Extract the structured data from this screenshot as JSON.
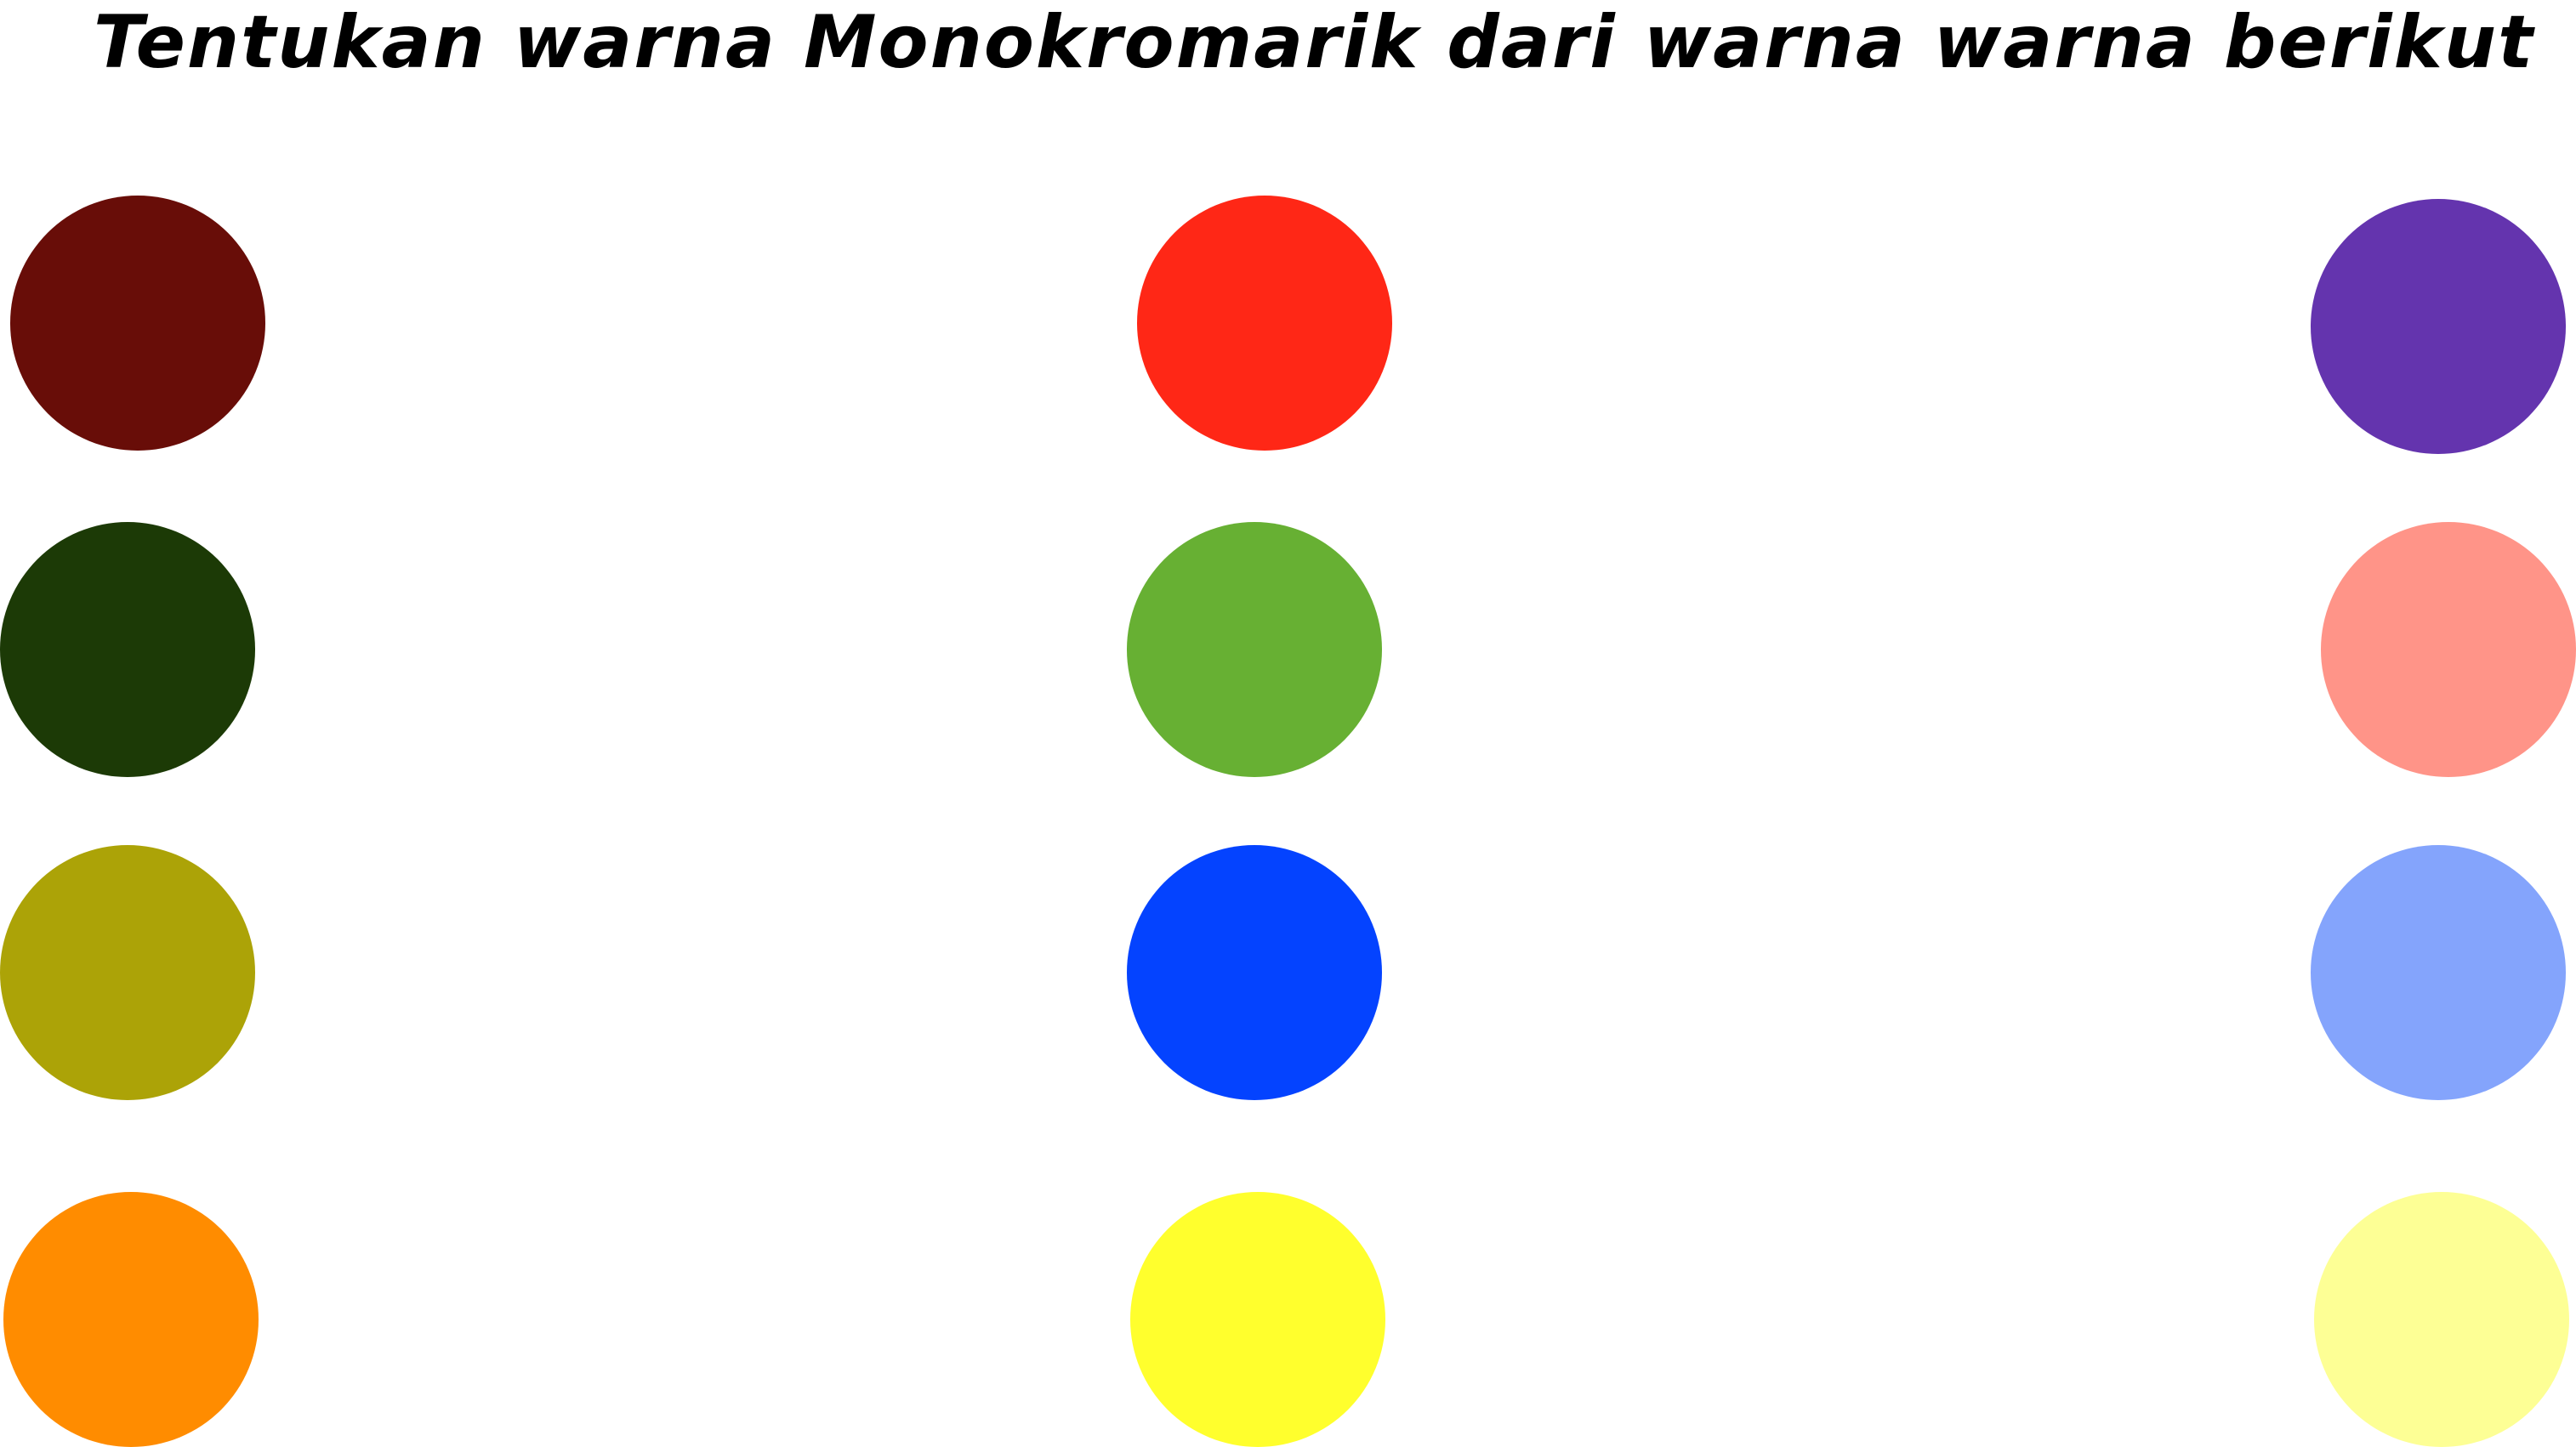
{
  "title": "Tentukan warna Monokromarik dari warna warna berikut",
  "swatches": {
    "col1": [
      "#680d08",
      "#1c3a06",
      "#aca307",
      "#ff8c00"
    ],
    "col2": [
      "#ff2716",
      "#67b033",
      "#0443ff",
      "#ffff2d"
    ],
    "col3": [
      "#6434ae",
      "#ff9488",
      "#84a4fc",
      "#fdff95"
    ]
  }
}
